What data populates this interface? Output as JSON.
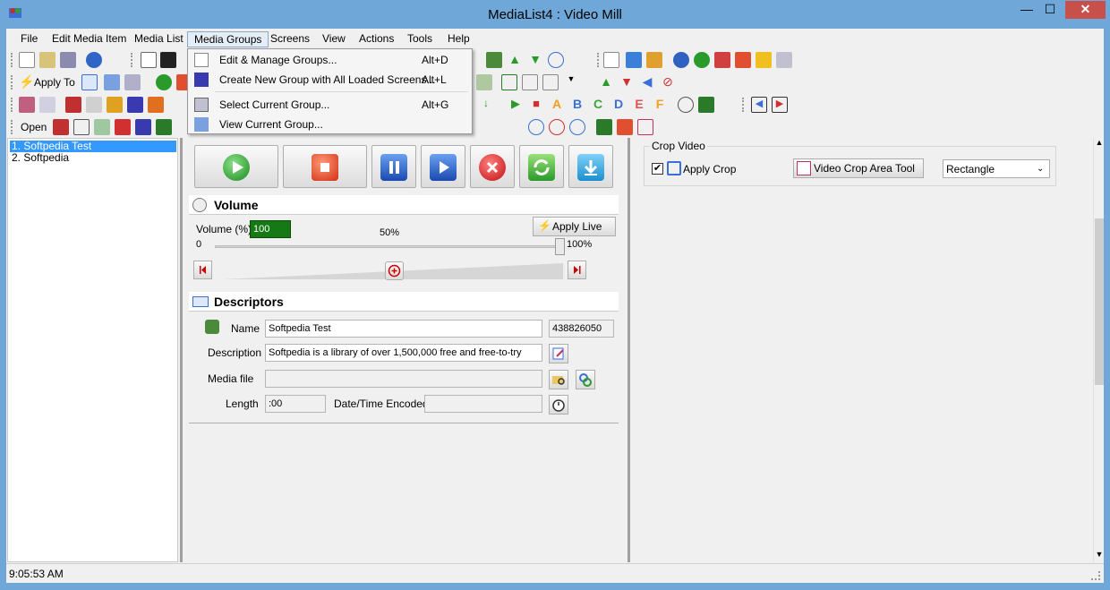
{
  "window": {
    "title": "MediaList4 : Video Mill",
    "minimize_glyph": "—",
    "maximize_glyph": "☐",
    "close_glyph": "✕"
  },
  "menubar": {
    "items": [
      "File",
      "Edit Media Item",
      "Media List",
      "Media Groups",
      "Screens",
      "View",
      "Actions",
      "Tools",
      "Help"
    ],
    "active": "Media Groups"
  },
  "toolbar": {
    "apply_to_label": "Apply To",
    "open_label": "Open",
    "letters": [
      "A",
      "B",
      "C",
      "D",
      "E",
      "F"
    ],
    "letter_colors": [
      "#f0a020",
      "#3a6fd8",
      "#3aa63a",
      "#3a6fd8",
      "#e05050",
      "#f0a020"
    ]
  },
  "media_groups_menu": {
    "items": [
      {
        "label": "Edit & Manage Groups...",
        "shortcut": "Alt+D",
        "icon": "edit-groups-icon"
      },
      {
        "label": "Create New Group with All Loaded Screens...",
        "shortcut": "Alt+L",
        "icon": "new-group-icon"
      },
      {
        "label": "Select Current Group...",
        "shortcut": "Alt+G",
        "icon": "select-group-icon"
      },
      {
        "label": "View Current Group...",
        "shortcut": "",
        "icon": "view-group-icon"
      }
    ]
  },
  "media_list": {
    "items": [
      "1. Softpedia Test",
      "2. Softpedia"
    ],
    "selected_index": 0
  },
  "playback": {
    "buttons": [
      "play-icon",
      "stop-icon",
      "pause-icon",
      "step-play-icon",
      "cancel-icon",
      "refresh-icon",
      "download-icon"
    ]
  },
  "volume": {
    "section_title": "Volume",
    "volume_label": "Volume (%)",
    "volume_value": "100",
    "apply_live_label": "Apply Live",
    "scale_min": "0",
    "scale_mid": "50%",
    "scale_max": "100%",
    "level_fraction": 1.0
  },
  "descriptors": {
    "section_title": "Descriptors",
    "name_label": "Name",
    "name_value": "Softpedia Test",
    "id_value": "438826050",
    "description_label": "Description",
    "description_value": "Softpedia is a library of over 1,500,000 free and free-to-try",
    "media_file_label": "Media file",
    "media_file_value": "",
    "length_label": "Length",
    "length_value": ":00",
    "date_label": "Date/Time Encoded",
    "date_value": ""
  },
  "crop": {
    "group_title": "Crop Video",
    "apply_crop_label": "Apply Crop",
    "apply_crop_checked": true,
    "tool_button_label": "Video Crop Area Tool",
    "shape_value": "Rectangle"
  },
  "status": {
    "time": "9:05:53 AM"
  }
}
